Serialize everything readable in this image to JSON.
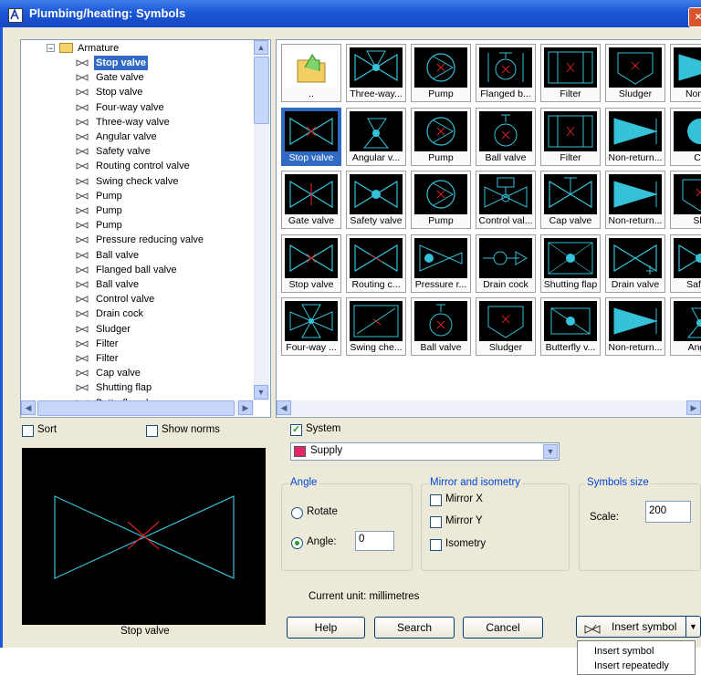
{
  "window": {
    "title": "Plumbing/heating: Symbols",
    "close_label": "×"
  },
  "tree": {
    "root_label": "Armature",
    "items": [
      {
        "label": "Stop valve",
        "selected": true
      },
      {
        "label": "Gate valve"
      },
      {
        "label": "Stop valve"
      },
      {
        "label": "Four-way valve"
      },
      {
        "label": "Three-way valve"
      },
      {
        "label": "Angular valve"
      },
      {
        "label": "Safety valve"
      },
      {
        "label": "Routing control valve"
      },
      {
        "label": "Swing check valve"
      },
      {
        "label": "Pump"
      },
      {
        "label": "Pump"
      },
      {
        "label": "Pump"
      },
      {
        "label": "Pressure reducing valve"
      },
      {
        "label": "Ball valve"
      },
      {
        "label": "Flanged ball valve"
      },
      {
        "label": "Ball valve"
      },
      {
        "label": "Control valve"
      },
      {
        "label": "Drain cock"
      },
      {
        "label": "Sludger"
      },
      {
        "label": "Filter"
      },
      {
        "label": "Filter"
      },
      {
        "label": "Cap valve"
      },
      {
        "label": "Shutting flap"
      },
      {
        "label": "Butterfly valve"
      }
    ]
  },
  "grid": {
    "rows": [
      [
        {
          "label": "..",
          "icon": "folder-up"
        },
        {
          "label": "Three-way...",
          "icon": "three-way-valve"
        },
        {
          "label": "Pump",
          "icon": "pump"
        },
        {
          "label": "Flanged b...",
          "icon": "flanged-ball-valve"
        },
        {
          "label": "Filter",
          "icon": "filter"
        },
        {
          "label": "Sludger",
          "icon": "sludger"
        },
        {
          "label": "Non-re",
          "icon": "non-return"
        }
      ],
      [
        {
          "label": "Stop valve",
          "icon": "stop-valve",
          "selected": true
        },
        {
          "label": "Angular v...",
          "icon": "angular-valve"
        },
        {
          "label": "Pump",
          "icon": "pump"
        },
        {
          "label": "Ball valve",
          "icon": "ball-valve"
        },
        {
          "label": "Filter",
          "icon": "filter"
        },
        {
          "label": "Non-return...",
          "icon": "non-return"
        },
        {
          "label": "Co",
          "icon": "control"
        }
      ],
      [
        {
          "label": "Gate valve",
          "icon": "gate-valve"
        },
        {
          "label": "Safety valve",
          "icon": "safety-valve"
        },
        {
          "label": "Pump",
          "icon": "pump"
        },
        {
          "label": "Control val...",
          "icon": "control-valve"
        },
        {
          "label": "Cap valve",
          "icon": "cap-valve"
        },
        {
          "label": "Non-return...",
          "icon": "non-return"
        },
        {
          "label": "Slu",
          "icon": "sludger"
        }
      ],
      [
        {
          "label": "Stop valve",
          "icon": "stop-valve"
        },
        {
          "label": "Routing c...",
          "icon": "routing-valve"
        },
        {
          "label": "Pressure r...",
          "icon": "pressure-valve"
        },
        {
          "label": "Drain cock",
          "icon": "drain-cock"
        },
        {
          "label": "Shutting flap",
          "icon": "shutting-flap"
        },
        {
          "label": "Drain valve",
          "icon": "drain-valve"
        },
        {
          "label": "Safety",
          "icon": "safety-valve"
        }
      ],
      [
        {
          "label": "Four-way ...",
          "icon": "four-way-valve"
        },
        {
          "label": "Swing che...",
          "icon": "swing-check"
        },
        {
          "label": "Ball valve",
          "icon": "ball-valve"
        },
        {
          "label": "Sludger",
          "icon": "sludger"
        },
        {
          "label": "Butterfly v...",
          "icon": "butterfly-valve"
        },
        {
          "label": "Non-return...",
          "icon": "non-return"
        },
        {
          "label": "Angle",
          "icon": "angular-valve"
        }
      ]
    ]
  },
  "options": {
    "sort_label": "Sort",
    "sort_checked": false,
    "show_norms_label": "Show norms",
    "show_norms_checked": false,
    "system_label": "System",
    "system_checked": true,
    "system_value": "Supply",
    "system_color": "#e8246a"
  },
  "preview": {
    "caption": "Stop valve"
  },
  "angle": {
    "title": "Angle",
    "rotate_label": "Rotate",
    "angle_label": "Angle:",
    "angle_value": "0",
    "selected": "angle"
  },
  "mirror": {
    "title": "Mirror and isometry",
    "mirror_x": "Mirror X",
    "mirror_y": "Mirror Y",
    "isometry": "Isometry"
  },
  "size": {
    "title": "Symbols size",
    "scale_label": "Scale:",
    "scale_value": "200"
  },
  "unit_text": "Current unit: millimetres",
  "buttons": {
    "help": "Help",
    "search": "Search",
    "cancel": "Cancel",
    "insert": "Insert symbol"
  },
  "menu": {
    "items": [
      "Insert symbol",
      "Insert repeatedly"
    ]
  },
  "colors": {
    "symbol_line": "#35c1d8",
    "symbol_red": "#d42020",
    "selection": "#316ac5"
  }
}
